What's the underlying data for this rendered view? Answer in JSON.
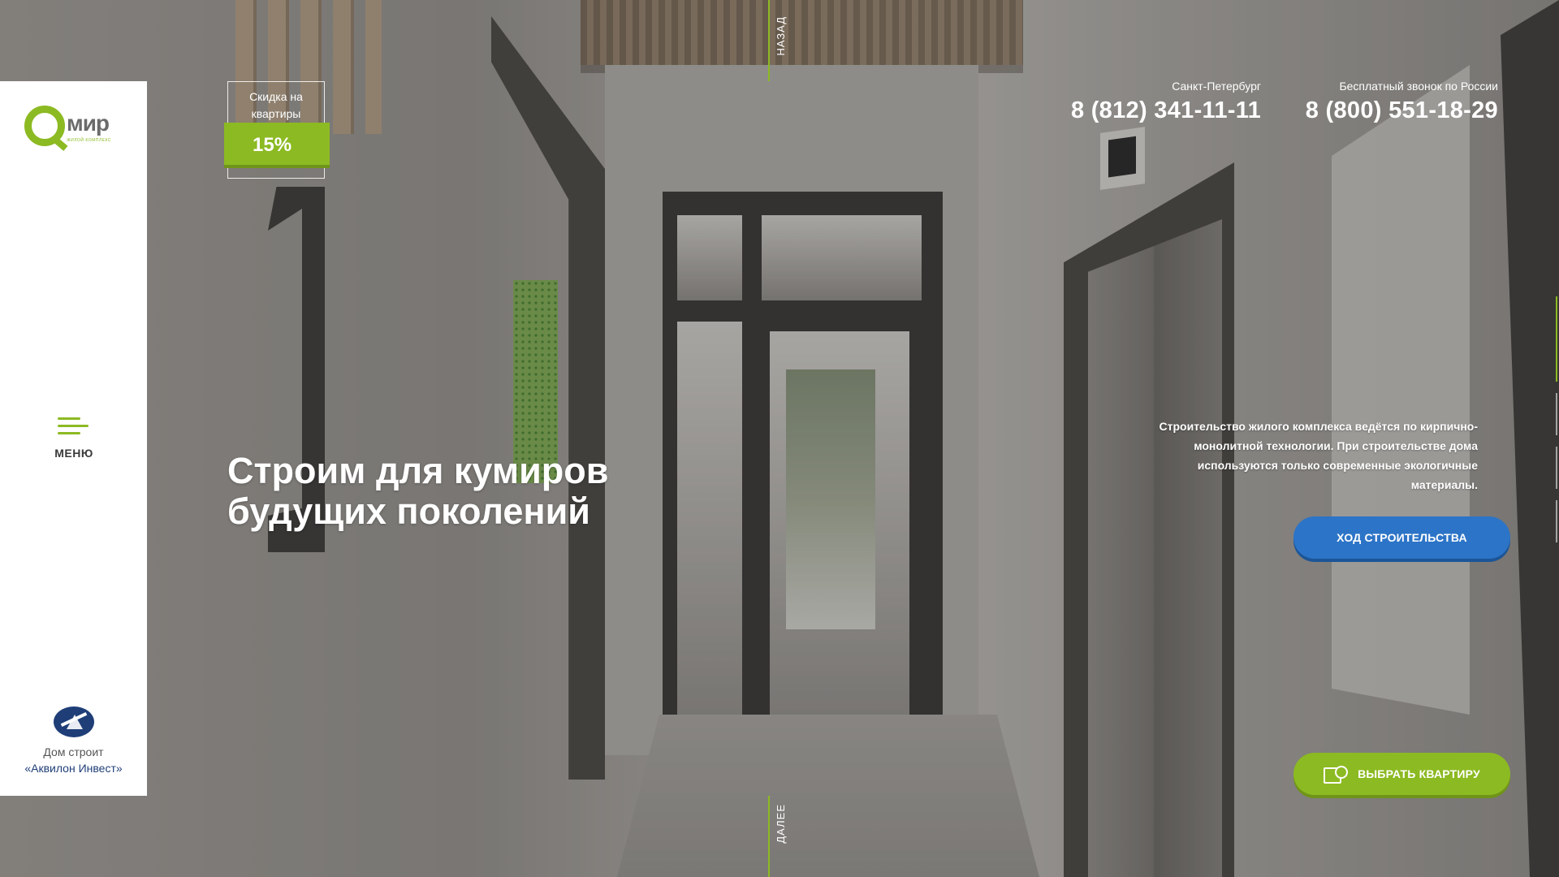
{
  "sidebar": {
    "logo_text": "мир",
    "logo_subtext": "ЖИЛОЙ КОМПЛЕКС",
    "menu_label": "МЕНЮ",
    "builder_line1": "Дом строит",
    "builder_line2": "«Аквилон Инвест»"
  },
  "discount": {
    "label": "Скидка на квартиры",
    "value": "15%"
  },
  "nav": {
    "back": "НАЗАД",
    "next": "ДАЛЕЕ"
  },
  "hero": {
    "headline": "Строим для кумиров будущих поколений",
    "info": "Строительство жилого комплекса ведётся по кирпично-монолитной технологии. При строительстве дома используются только современные экологичные материалы."
  },
  "contacts": {
    "spb_caption": "Санкт-Петербург",
    "spb_phone": "8 (812) 341-11-11",
    "free_caption": "Бесплатный звонок по России",
    "free_phone": "8 (800) 551-18-29"
  },
  "buttons": {
    "progress": "ХОД СТРОИТЕЛЬСТВА",
    "choose": "ВЫБРАТЬ КВАРТИРУ"
  },
  "slider": {
    "count": 5,
    "active_index": 0
  },
  "colors": {
    "brand_green": "#8cba22",
    "brand_blue": "#2c74c7",
    "builder_blue": "#1f3e78"
  },
  "icons": {
    "logo": "q-mir-logo",
    "menu": "hamburger-icon",
    "builder": "akvilon-logo",
    "choose": "building-search-icon"
  }
}
